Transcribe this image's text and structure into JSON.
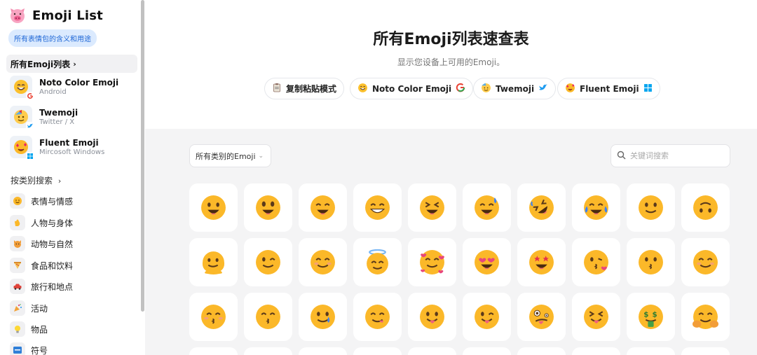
{
  "brand": {
    "title": "Emoji List",
    "tagline": "所有表情包的含义和用途"
  },
  "sidebar": {
    "active_item": "所有Emoji列表",
    "vendors": [
      {
        "name": "Noto Color Emoji",
        "sub": "Android",
        "icon": "google-logo-icon"
      },
      {
        "name": "Twemoji",
        "sub": "Twitter / X",
        "icon": "twitter-logo-icon"
      },
      {
        "name": "Fluent Emoji",
        "sub": "Mircosoft Windows",
        "icon": "windows-logo-icon"
      }
    ],
    "section_title": "按类别搜索",
    "categories": [
      {
        "label": "表情与情感",
        "icon": "smiley-icon"
      },
      {
        "label": "人物与身体",
        "icon": "hand-icon"
      },
      {
        "label": "动物与自然",
        "icon": "cat-icon"
      },
      {
        "label": "食品和饮料",
        "icon": "pizza-icon"
      },
      {
        "label": "旅行和地点",
        "icon": "car-icon"
      },
      {
        "label": "活动",
        "icon": "party-popper-icon"
      },
      {
        "label": "物品",
        "icon": "lightbulb-icon"
      },
      {
        "label": "符号",
        "icon": "atm-icon"
      }
    ]
  },
  "header": {
    "title": "所有Emoji列表速查表",
    "subtitle": "显示您设备上可用的Emoji。",
    "pills": [
      {
        "label": "复制粘贴模式",
        "icon": "clipboard-icon"
      },
      {
        "label": "Noto Color Emoji",
        "icon": "google-logo-icon"
      },
      {
        "label": "Twemoji",
        "icon": "twitter-logo-icon"
      },
      {
        "label": "Fluent Emoji",
        "icon": "windows-logo-icon"
      }
    ]
  },
  "controls": {
    "category_select": "所有类别的Emoji",
    "search_placeholder": "关键词搜索"
  },
  "colors": {
    "accent": "#1d66d6",
    "emoji_yellow": "#fbb829",
    "page_bg": "#f4f4f5"
  },
  "emoji_grid": [
    [
      "grinning-face",
      "grinning-face-big-eyes",
      "grinning-face-smiling-eyes",
      "beaming-face",
      "squinting-face",
      "grinning-face-sweat",
      "rolling-on-floor-laughing",
      "face-tears-of-joy",
      "slightly-smiling-face",
      "upside-down-face"
    ],
    [
      "melting-face",
      "winking-face",
      "smiling-face-smiling-eyes",
      "smiling-face-halo",
      "smiling-face-hearts",
      "heart-eyes",
      "star-struck",
      "face-blowing-kiss",
      "kissing-face",
      "smiling-face"
    ],
    [
      "kissing-face-closed-eyes",
      "kissing-face-smiling-eyes",
      "smiling-face-tear",
      "face-savoring-food",
      "face-with-tongue",
      "winking-face-tongue",
      "zany-face",
      "squinting-face-tongue",
      "money-mouth-face",
      "hugging-face"
    ]
  ]
}
